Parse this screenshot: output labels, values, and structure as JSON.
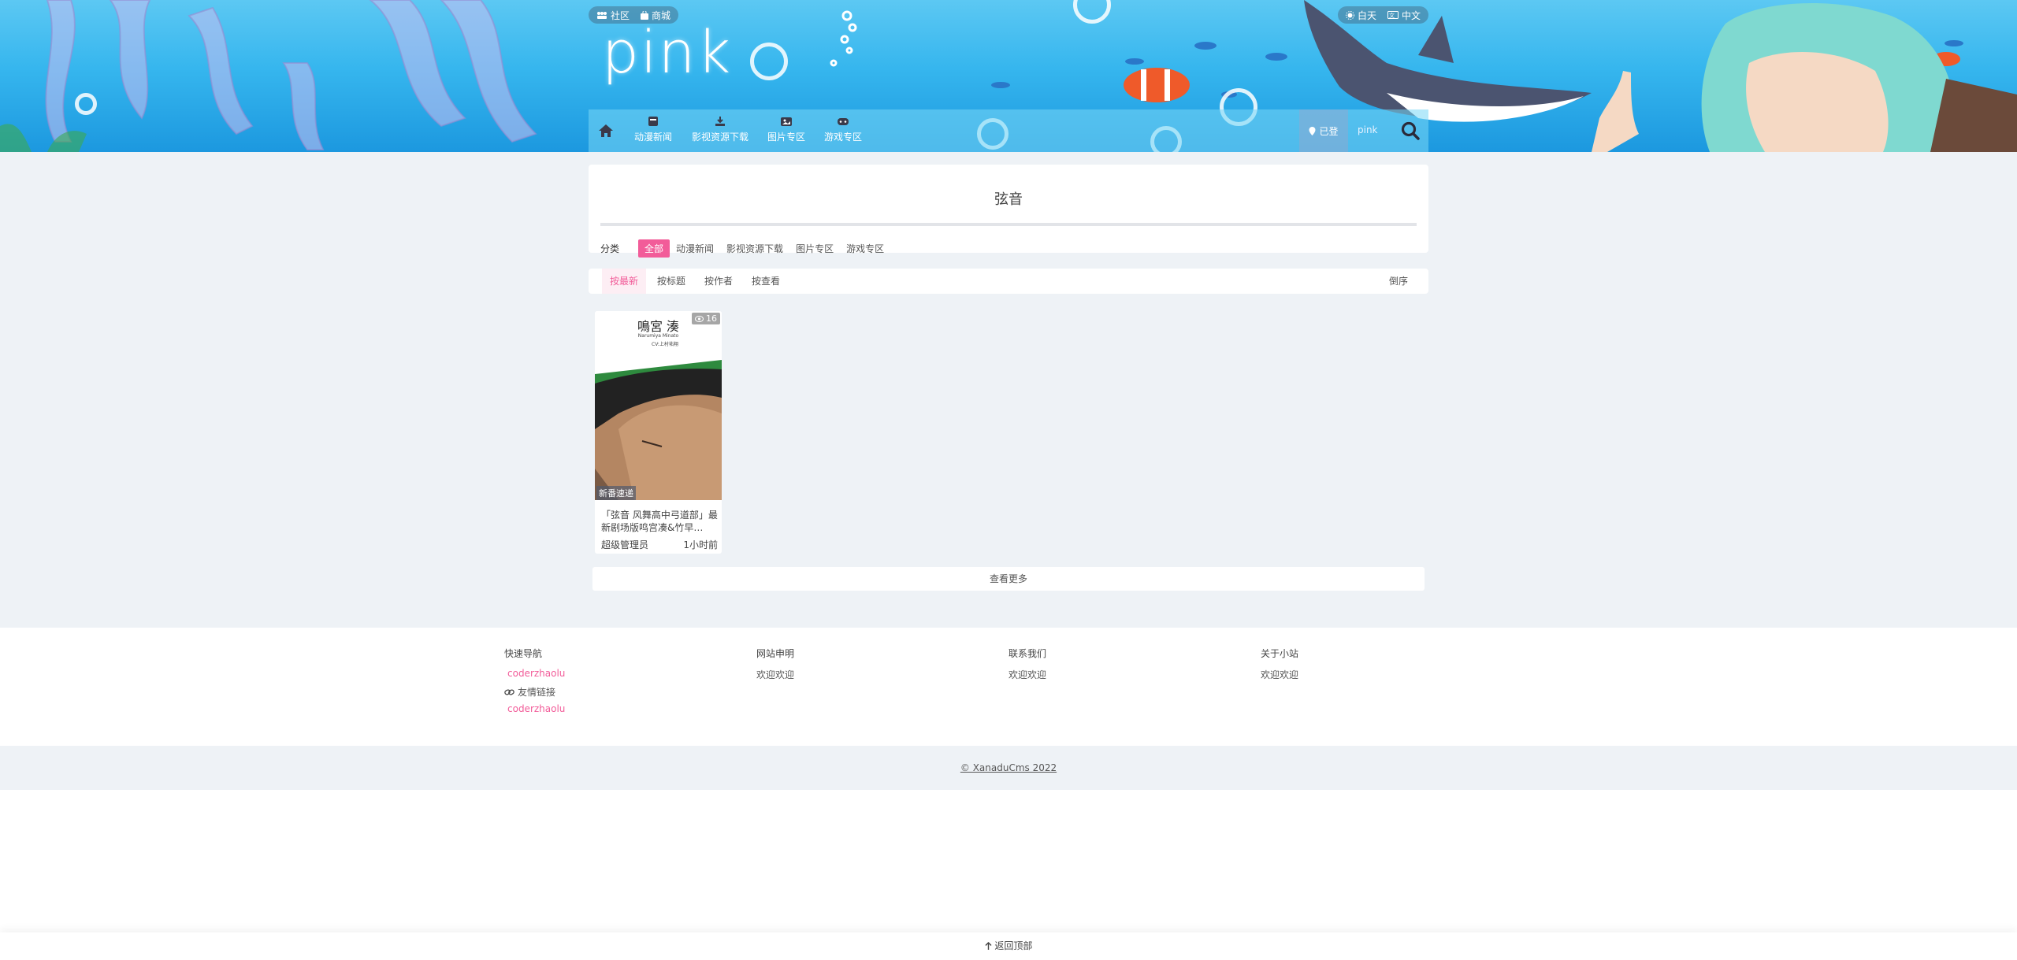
{
  "header": {
    "top_links": [
      {
        "icon": "community-icon",
        "label": "社区"
      },
      {
        "icon": "shop-icon",
        "label": "商城"
      }
    ],
    "top_right": [
      {
        "icon": "sun-icon",
        "label": "白天"
      },
      {
        "icon": "language-icon",
        "label": "中文"
      }
    ],
    "logo_text": "pink"
  },
  "nav": {
    "home_icon": "home-icon",
    "items": [
      {
        "icon": "news-icon",
        "label": "动漫新闻"
      },
      {
        "icon": "download-icon",
        "label": "影视资源下载"
      },
      {
        "icon": "image-icon",
        "label": "图片专区"
      },
      {
        "icon": "gamepad-icon",
        "label": "游戏专区"
      }
    ],
    "login_label": "已登",
    "user_label": "pink",
    "search_icon": "search-icon"
  },
  "category": {
    "title": "弦音",
    "label": "分类",
    "options": [
      "全部",
      "动漫新闻",
      "影视资源下载",
      "图片专区",
      "游戏专区"
    ],
    "active_index": 0
  },
  "sort": {
    "options": [
      "按最新",
      "按标题",
      "按作者",
      "按查看"
    ],
    "active_index": 0,
    "order_label": "倒序"
  },
  "posts": [
    {
      "views": "16",
      "tag": "新番速递",
      "title": "「弦音 风舞高中弓道部」最新剧场版鸣宫凑&竹早…",
      "author": "超级管理员",
      "time": "1小时前",
      "thumb_text_top": "鳴宮 湊",
      "thumb_text_sub": "Narumiya Minato",
      "thumb_text_cv": "CV:上村祐翔"
    }
  ],
  "more_label": "查看更多",
  "footer": {
    "columns": [
      {
        "head": "快速导航",
        "link": "coderzhaolu",
        "row_label": "友情链接",
        "row_icon": "link-icon",
        "link2": "coderzhaolu"
      },
      {
        "head": "网站申明",
        "text": "欢迎欢迎"
      },
      {
        "head": "联系我们",
        "text": "欢迎欢迎"
      },
      {
        "head": "关于小站",
        "text": "欢迎欢迎"
      }
    ],
    "copyright": "© XanaduCms 2022"
  },
  "back_top": "返回顶部",
  "colors": {
    "accent": "#f25c99",
    "nav_bg": "#78d7f5"
  }
}
